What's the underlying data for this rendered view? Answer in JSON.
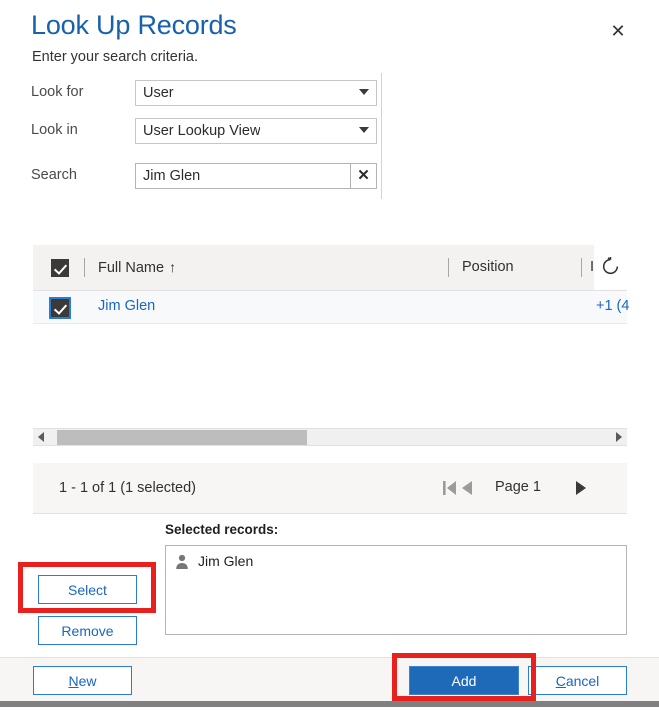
{
  "dialog": {
    "title": "Look Up Records",
    "subtitle": "Enter your search criteria.",
    "close_icon": "close-icon"
  },
  "criteria": {
    "look_for": {
      "label": "Look for",
      "value": "User"
    },
    "look_in": {
      "label": "Look in",
      "value": "User Lookup View"
    },
    "search": {
      "label": "Search",
      "value": "Jim Glen",
      "clear_icon": "✕"
    }
  },
  "grid": {
    "columns": [
      {
        "label": "Full Name",
        "sort": "↑"
      },
      {
        "label": "Position",
        "sort": ""
      }
    ],
    "refresh_icon": "refresh-icon",
    "rows": [
      {
        "full_name": "Jim Glen",
        "position": "",
        "phone": "+1 (4",
        "checked": true
      }
    ]
  },
  "pagination": {
    "count_text": "1 - 1 of 1 (1 selected)",
    "page_label": "Page 1"
  },
  "selected_records": {
    "label": "Selected records:",
    "items": [
      {
        "name": "Jim Glen",
        "icon": "person-icon"
      }
    ]
  },
  "side_buttons": {
    "select": "Select",
    "remove": "Remove"
  },
  "footer": {
    "new": {
      "accel": "N",
      "rest": "ew"
    },
    "add": "Add",
    "cancel": {
      "accel": "C",
      "rest": "ancel"
    }
  },
  "annotations": {
    "highlight_color": "#e8201e"
  }
}
